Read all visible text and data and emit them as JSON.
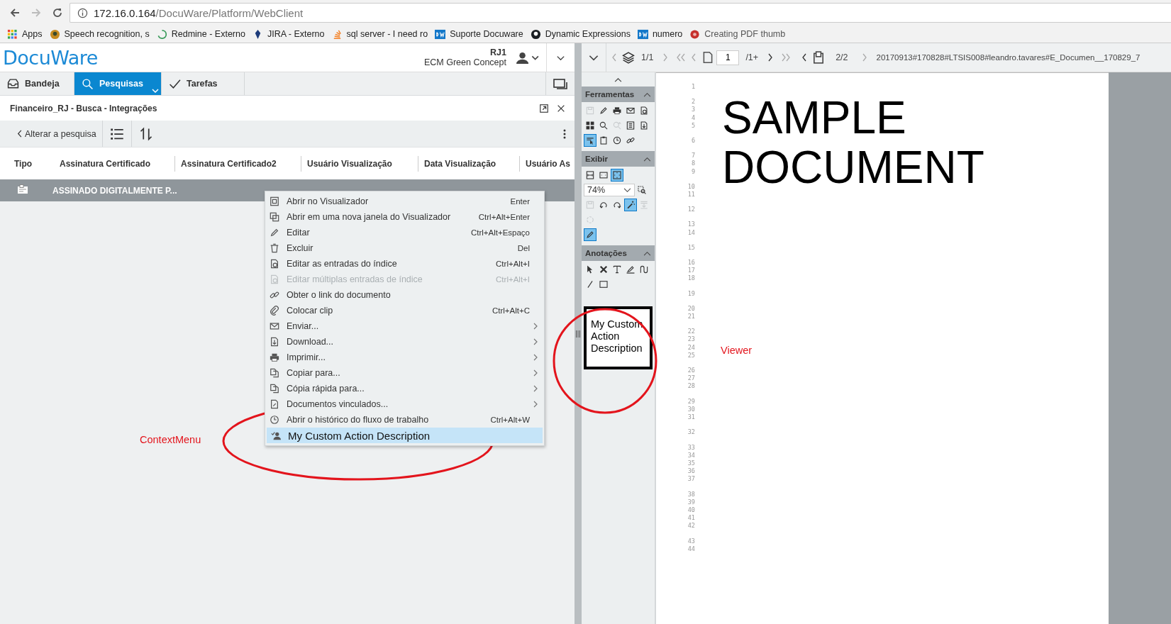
{
  "browser": {
    "url_host": "172.16.0.164",
    "url_path": "/DocuWare/Platform/WebClient"
  },
  "bookmarks": [
    {
      "kind": "apps",
      "label": "Apps"
    },
    {
      "kind": "bot",
      "label": "Speech recognition, s"
    },
    {
      "kind": "spinner",
      "label": "Redmine - Externo"
    },
    {
      "kind": "jira",
      "label": "JIRA - Externo"
    },
    {
      "kind": "stack",
      "label": "sql server - I need ro"
    },
    {
      "kind": "dw",
      "label": "Suporte Docuware"
    },
    {
      "kind": "github",
      "label": "Dynamic Expressions"
    },
    {
      "kind": "dw",
      "label": "numero"
    },
    {
      "kind": "pdf",
      "label": "Creating PDF thumb"
    }
  ],
  "app": {
    "logo": "DocuWare",
    "user": "RJ1",
    "org": "ECM Green Concept"
  },
  "tabs": [
    {
      "kind": "tray",
      "label": "Bandeja",
      "selected": false
    },
    {
      "kind": "search",
      "label": "Pesquisas",
      "selected": true
    },
    {
      "kind": "check",
      "label": "Tarefas",
      "selected": false
    }
  ],
  "search": {
    "title": "Financeiro_RJ - Busca - Integrações",
    "back": "Alterar a pesquisa"
  },
  "table": {
    "columns": [
      "Tipo",
      "Assinatura Certificado",
      "Assinatura Certificado2",
      "Usuário Visualização",
      "Data Visualização",
      "Usuário As"
    ],
    "rows": [
      {
        "cells": [
          "",
          "ASSINADO DIGITALMENTE P..."
        ],
        "selected": true
      }
    ]
  },
  "context_menu": [
    {
      "kind": "viewer",
      "label": "Abrir no Visualizador",
      "shortcut": "Enter",
      "submenu": false,
      "disabled": false,
      "selected": false
    },
    {
      "kind": "new-window",
      "label": "Abrir em uma nova janela do Visualizador",
      "shortcut": "Ctrl+Alt+Enter",
      "submenu": false,
      "disabled": false,
      "selected": false
    },
    {
      "kind": "pencil",
      "label": "Editar",
      "shortcut": "Ctrl+Alt+Espaço",
      "submenu": false,
      "disabled": false,
      "selected": false
    },
    {
      "kind": "trash",
      "label": "Excluir",
      "shortcut": "Del",
      "submenu": false,
      "disabled": false,
      "selected": false
    },
    {
      "kind": "doc-info",
      "label": "Editar as entradas do índice",
      "shortcut": "Ctrl+Alt+I",
      "submenu": false,
      "disabled": false,
      "selected": false
    },
    {
      "kind": "doc-info",
      "label": "Editar múltiplas entradas de índice",
      "shortcut": "Ctrl+Alt+I",
      "submenu": false,
      "disabled": true,
      "selected": false
    },
    {
      "kind": "link",
      "label": "Obter o link do documento",
      "submenu": false,
      "disabled": false,
      "selected": false
    },
    {
      "kind": "clip",
      "label": "Colocar clip",
      "shortcut": "Ctrl+Alt+C",
      "submenu": false,
      "disabled": false,
      "selected": false
    },
    {
      "kind": "mail",
      "label": "Enviar...",
      "submenu": true,
      "disabled": false,
      "selected": false
    },
    {
      "kind": "doc-down",
      "label": "Download...",
      "submenu": true,
      "disabled": false,
      "selected": false
    },
    {
      "kind": "printer",
      "label": "Imprimir...",
      "submenu": true,
      "disabled": false,
      "selected": false
    },
    {
      "kind": "copy",
      "label": "Copiar para...",
      "submenu": true,
      "disabled": false,
      "selected": false
    },
    {
      "kind": "copy",
      "label": "Cópia rápida para...",
      "submenu": true,
      "disabled": false,
      "selected": false
    },
    {
      "kind": "linked-doc",
      "label": "Documentos vinculados...",
      "submenu": true,
      "disabled": false,
      "selected": false
    },
    {
      "kind": "history",
      "label": "Abrir o histórico do fluxo de trabalho",
      "shortcut": "Ctrl+Alt+W",
      "submenu": false,
      "disabled": false,
      "selected": false
    },
    {
      "kind": "person-check",
      "label": "My Custom Action Description",
      "submenu": false,
      "disabled": false,
      "selected": true
    }
  ],
  "viewer": {
    "layer_counter": "1/1",
    "page_input": "1",
    "page_total": "/1+",
    "doc_counter": "2/2",
    "filename": "20170913#170828#LTSIS008#leandro.tavares#E_Documen__170829_7",
    "sections": [
      {
        "title": "Ferramentas",
        "rows": [
          [
            {
              "kind": "save",
              "selected": false,
              "disabled": true
            },
            {
              "kind": "pencil",
              "selected": false,
              "disabled": false
            },
            {
              "kind": "printer",
              "selected": false,
              "disabled": false
            },
            {
              "kind": "mail",
              "selected": false,
              "disabled": false
            },
            {
              "kind": "doc-info",
              "selected": false,
              "disabled": false
            }
          ],
          [
            {
              "kind": "grid",
              "selected": false,
              "disabled": false
            },
            {
              "kind": "search",
              "selected": false,
              "disabled": false
            },
            {
              "kind": "search-redo",
              "selected": false,
              "disabled": true
            },
            {
              "kind": "list-info",
              "selected": false,
              "disabled": false
            },
            {
              "kind": "doc-down",
              "selected": false,
              "disabled": false
            }
          ],
          [
            {
              "kind": "text-select",
              "selected": true,
              "disabled": false
            },
            {
              "kind": "clipboard",
              "selected": false,
              "disabled": false
            },
            {
              "kind": "history",
              "selected": false,
              "disabled": false
            },
            {
              "kind": "link",
              "selected": false,
              "disabled": false
            }
          ]
        ]
      },
      {
        "title": "Exibir",
        "rows": [
          [
            {
              "kind": "fit-width",
              "selected": false,
              "disabled": false
            },
            {
              "kind": "fit-height",
              "selected": false,
              "disabled": false
            },
            {
              "kind": "fit-page",
              "selected": true,
              "disabled": false
            }
          ],
          [
            {
              "kind": "zoom-select",
              "value": "74%"
            },
            {
              "kind": "zoom-rect",
              "selected": false,
              "disabled": false
            }
          ],
          [
            {
              "kind": "save",
              "selected": false,
              "disabled": true
            },
            {
              "kind": "rotate-left",
              "selected": false,
              "disabled": false
            },
            {
              "kind": "rotate-right",
              "selected": false,
              "disabled": false
            },
            {
              "kind": "wand",
              "selected": true,
              "disabled": false
            },
            {
              "kind": "stamp",
              "selected": false,
              "disabled": true
            }
          ],
          [
            {
              "kind": "rotate-circle",
              "selected": false,
              "disabled": true
            }
          ],
          [
            {
              "kind": "pencil",
              "selected": true,
              "disabled": false
            }
          ]
        ]
      },
      {
        "title": "Anotações",
        "rows": [
          [
            {
              "kind": "cursor",
              "selected": false,
              "disabled": false
            },
            {
              "kind": "cross",
              "selected": false,
              "disabled": false
            },
            {
              "kind": "text-tool",
              "selected": false,
              "disabled": false
            },
            {
              "kind": "highlighter",
              "selected": false,
              "disabled": false
            },
            {
              "kind": "curve",
              "selected": false,
              "disabled": false
            }
          ],
          [
            {
              "kind": "line",
              "selected": false,
              "disabled": false
            },
            {
              "kind": "rectangle",
              "selected": false,
              "disabled": false
            }
          ]
        ]
      }
    ],
    "custom_action": "My Custom Action Description",
    "document": {
      "title_lines": [
        "SAMPLE",
        "DOCUMENT"
      ],
      "line_groups": [
        [
          "1"
        ],
        [
          "2",
          "3",
          "4",
          "5"
        ],
        [
          "6"
        ],
        [
          "7",
          "8",
          "9"
        ],
        [
          "10",
          "11"
        ],
        [
          "12"
        ],
        [
          "13",
          "14"
        ],
        [
          "15"
        ],
        [
          "16",
          "17",
          "18"
        ],
        [
          "19"
        ],
        [
          "20",
          "21"
        ],
        [
          "22",
          "23",
          "24",
          "25"
        ],
        [
          "26",
          "27",
          "28"
        ],
        [
          "29",
          "30",
          "31"
        ],
        [
          "32"
        ],
        [
          "33",
          "34",
          "35",
          "36",
          "37"
        ],
        [
          "38",
          "39",
          "40",
          "41",
          "42"
        ],
        [
          "43",
          "44"
        ]
      ]
    }
  },
  "annotations": [
    {
      "label": "ContextMenu"
    },
    {
      "label": "Viewer"
    }
  ]
}
